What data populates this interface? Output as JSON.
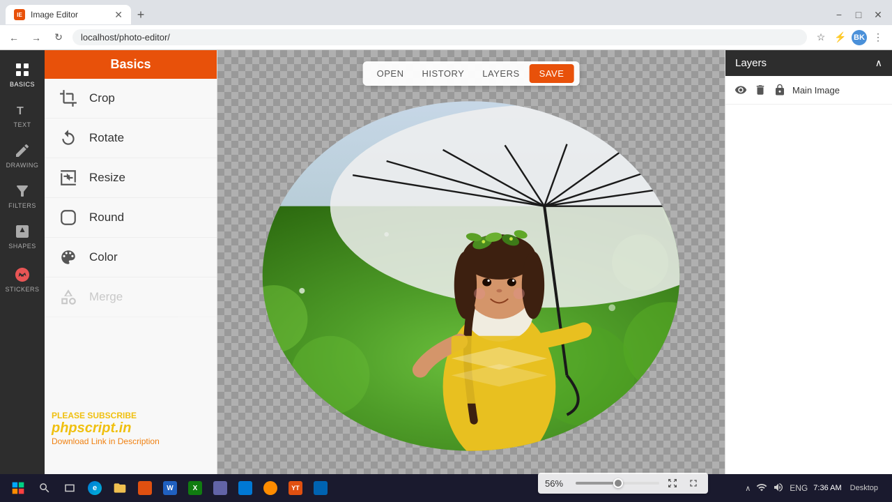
{
  "browser": {
    "tab_title": "Image Editor",
    "tab_favicon": "IE",
    "url": "localhost/photo-editor/",
    "new_tab_label": "+"
  },
  "toolbar": {
    "open_label": "OPEN",
    "history_label": "HISTORY",
    "layers_label": "LAYERS",
    "save_label": "SAVE"
  },
  "sidebar": {
    "items": [
      {
        "id": "basics",
        "label": "BASICS",
        "active": true
      },
      {
        "id": "text",
        "label": "TEXT"
      },
      {
        "id": "drawing",
        "label": "DRAWING"
      },
      {
        "id": "filters",
        "label": "FILTERS"
      },
      {
        "id": "shapes",
        "label": "SHAPES"
      },
      {
        "id": "stickers",
        "label": "STICKERS"
      }
    ]
  },
  "tools": {
    "header_label": "Basics",
    "items": [
      {
        "id": "crop",
        "label": "Crop"
      },
      {
        "id": "rotate",
        "label": "Rotate"
      },
      {
        "id": "resize",
        "label": "Resize"
      },
      {
        "id": "round",
        "label": "Round"
      },
      {
        "id": "color",
        "label": "Color"
      },
      {
        "id": "merge",
        "label": "Merge",
        "disabled": true
      }
    ]
  },
  "layers": {
    "panel_title": "Layers",
    "items": [
      {
        "id": "main",
        "label": "Main Image"
      }
    ]
  },
  "zoom": {
    "percent": "56%",
    "value": 56
  },
  "watermark": {
    "line1": "PLEASE SUBSCRIBE",
    "line2": "phpscript.in",
    "line3": "Download Link in Description"
  },
  "taskbar": {
    "time": "7:36 AM",
    "date": "",
    "desktop_label": "Desktop"
  },
  "colors": {
    "accent": "#e8510a",
    "sidebar_bg": "#2d2d2d",
    "layers_header_bg": "#2d2d2d",
    "tools_header_bg": "#e8510a"
  }
}
